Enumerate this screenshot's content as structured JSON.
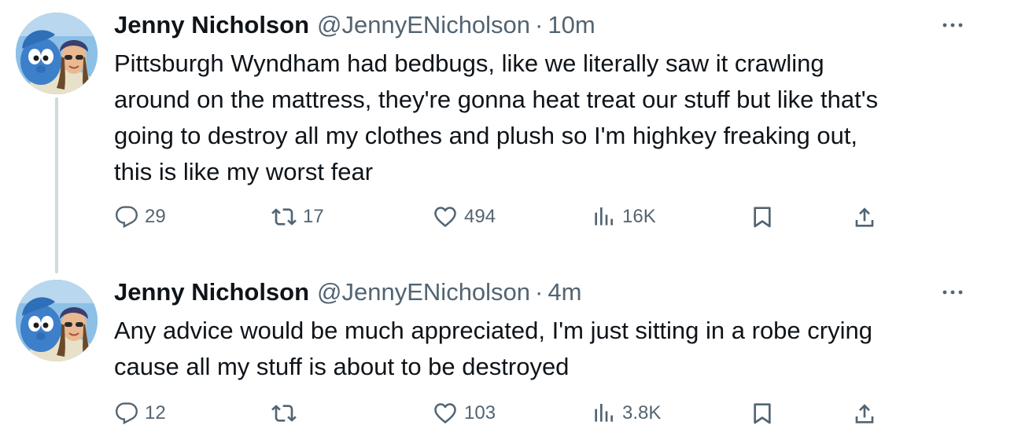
{
  "tweets": [
    {
      "author": {
        "name": "Jenny Nicholson",
        "handle": "@JennyENicholson",
        "avatar_icon": "smurf-avatar-photo"
      },
      "separator": "·",
      "time": "10m",
      "text": "Pittsburgh Wyndham had bedbugs, like we literally saw it crawling\naround on the mattress, they're gonna heat treat our stuff but like that's\ngoing to destroy all my clothes and plush so I'm highkey freaking out,\nthis is like my worst fear",
      "stats": {
        "replies": "29",
        "retweets": "17",
        "likes": "494",
        "views": "16K"
      }
    },
    {
      "author": {
        "name": "Jenny Nicholson",
        "handle": "@JennyENicholson",
        "avatar_icon": "smurf-avatar-photo"
      },
      "separator": "·",
      "time": "4m",
      "text": "Any advice would be much appreciated, I'm just sitting in a robe crying\ncause all my stuff is about to be destroyed",
      "stats": {
        "replies": "12",
        "retweets": "",
        "likes": "103",
        "views": "3.8K"
      }
    }
  ],
  "icons": {
    "reply": "reply-icon",
    "retweet": "retweet-icon",
    "like": "heart-icon",
    "views": "views-icon",
    "bookmark": "bookmark-icon",
    "share": "share-icon",
    "more": "more-dots-icon"
  },
  "colors": {
    "text": "#0f1419",
    "secondary": "#536471",
    "thread_line": "#cfd9de"
  }
}
